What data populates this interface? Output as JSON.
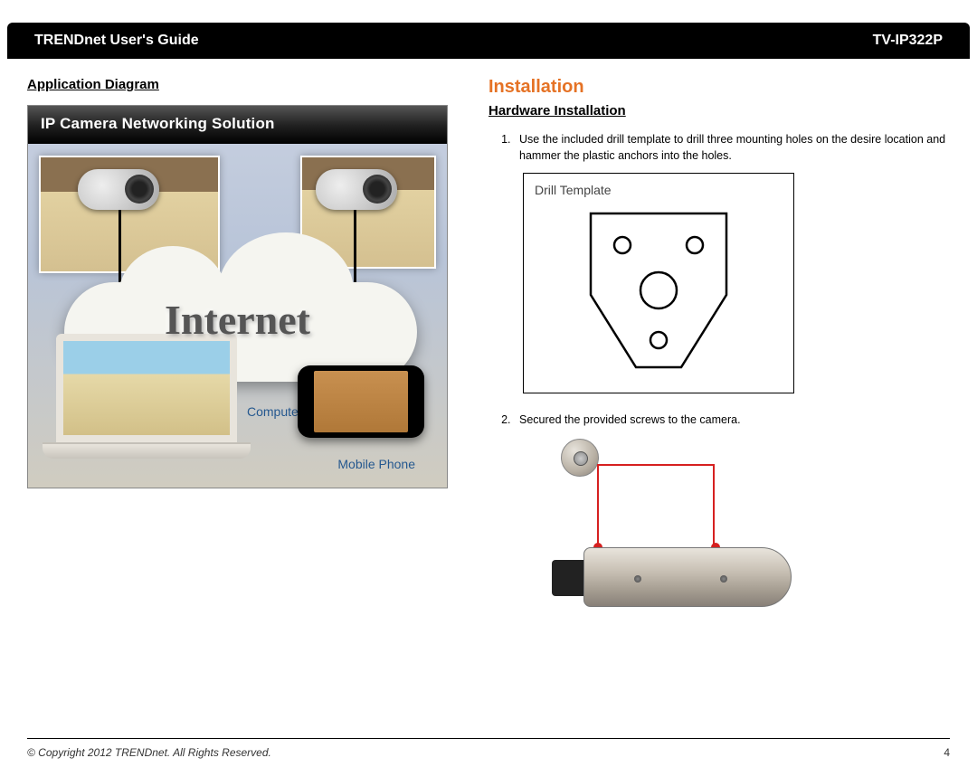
{
  "header": {
    "left": "TRENDnet User's Guide",
    "right": "TV-IP322P"
  },
  "left": {
    "heading": "Application Diagram",
    "diagram": {
      "title": "IP Camera Networking Solution",
      "cloud_label": "Internet",
      "computer_label": "Computer",
      "mobile_label": "Mobile Phone"
    }
  },
  "right": {
    "title": "Installation",
    "subheading": "Hardware Installation",
    "steps": [
      "Use the included drill template to drill three mounting holes on the desire location and hammer the plastic anchors into the holes.",
      "Secured the provided screws to the camera."
    ],
    "drill_label": "Drill Template"
  },
  "footer": {
    "copyright": "© Copyright 2012 TRENDnet. All Rights Reserved.",
    "page": "4"
  }
}
